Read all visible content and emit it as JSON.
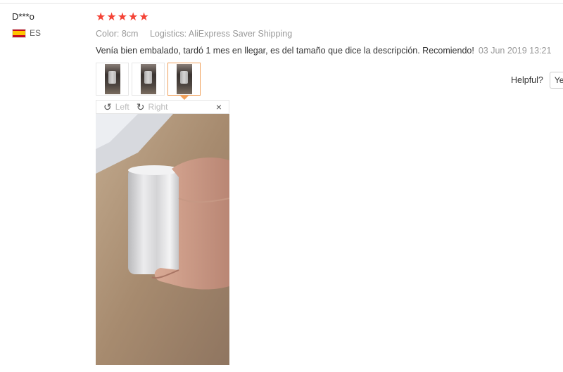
{
  "reviewer": {
    "name": "D***o",
    "country_code": "ES",
    "flag_icon": "spain-flag-icon"
  },
  "rating": {
    "stars": 5,
    "max": 5,
    "color": "#f44336"
  },
  "meta": {
    "color_label": "Color:",
    "color_value": "8cm",
    "logistics_label": "Logistics:",
    "logistics_value": "AliExpress Saver Shipping"
  },
  "feedback": {
    "text": "Venía bien embalado, tardó 1 mes en llegar, es del tamaño que dice la descripción. Recomiendo!",
    "date": "03 Jun 2019 13:21"
  },
  "thumbnails": {
    "count": 3,
    "active_index": 2,
    "active_color": "#f0a05a"
  },
  "viewer": {
    "rotate_left_label": "Left",
    "rotate_right_label": "Right",
    "close_symbol": "×"
  },
  "helpful": {
    "label": "Helpful?",
    "yes_label": "Ye"
  }
}
